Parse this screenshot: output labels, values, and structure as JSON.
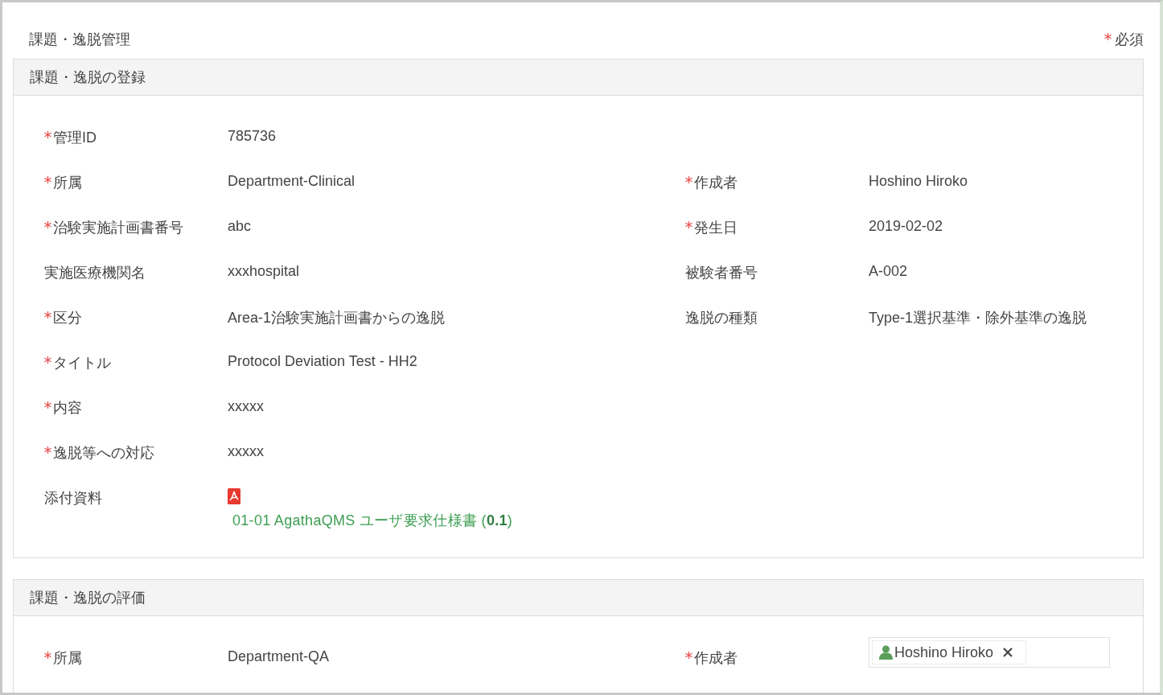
{
  "page_title": "課題・逸脱管理",
  "required_note": {
    "required": true,
    "label": "必須"
  },
  "sections": [
    {
      "title": "課題・逸脱の登録",
      "rows": [
        {
          "left": {
            "label": "管理ID",
            "required": true,
            "value": "785736"
          }
        },
        {
          "left": {
            "label": "所属",
            "required": true,
            "value": "Department-Clinical"
          },
          "right": {
            "label": "作成者",
            "required": true,
            "value": "Hoshino Hiroko",
            "kind": "text"
          }
        },
        {
          "left": {
            "label": "治験実施計画書番号",
            "required": true,
            "value": "abc"
          },
          "right": {
            "label": "発生日",
            "required": true,
            "value": "2019-02-02",
            "kind": "text"
          }
        },
        {
          "left": {
            "label": "実施医療機関名",
            "required": false,
            "value": "xxxhospital"
          },
          "right": {
            "label": "被験者番号",
            "required": false,
            "value": "A-002",
            "kind": "text"
          }
        },
        {
          "left": {
            "label": "区分",
            "required": true,
            "value": "Area-1治験実施計画書からの逸脱"
          },
          "right": {
            "label": "逸脱の種類",
            "required": false,
            "value": "Type-1選択基準・除外基準の逸脱",
            "kind": "text"
          }
        },
        {
          "left": {
            "label": "タイトル",
            "required": true,
            "value": "Protocol Deviation Test - HH2"
          }
        },
        {
          "left": {
            "label": "内容",
            "required": true,
            "value": "xxxxx"
          }
        },
        {
          "left": {
            "label": "逸脱等への対応",
            "required": true,
            "value": "xxxxx"
          }
        }
      ],
      "attachments": {
        "label": "添付資料",
        "required": false,
        "files": [
          {
            "name": "01-01 AgathaQMS ユーザ要求仕様書 (**0.1**)"
          }
        ]
      }
    },
    {
      "title": "課題・逸脱の評価",
      "rows": [
        {
          "left": {
            "label": "所属",
            "required": true,
            "value": "Department-QA"
          },
          "right": {
            "label": "作成者",
            "required": true,
            "value": "Hoshino Hiroko",
            "kind": "user-tag"
          }
        }
      ]
    }
  ]
}
